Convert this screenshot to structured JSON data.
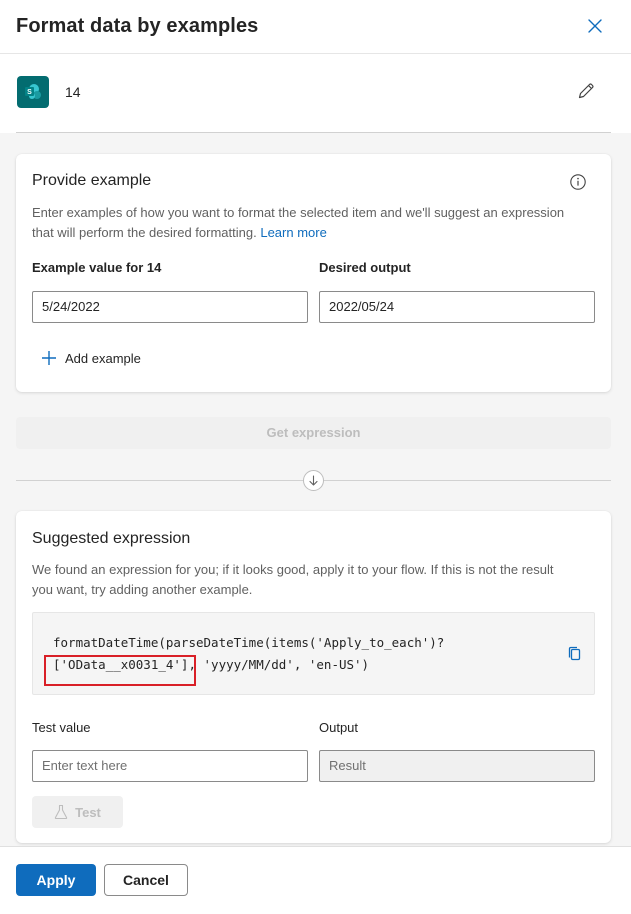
{
  "panel": {
    "title": "Format data by examples",
    "close_icon": "close-icon"
  },
  "connector": {
    "icon": "sharepoint-icon",
    "icon_color": "#036c70",
    "label": "14",
    "edit_icon": "pencil-icon"
  },
  "provide_example": {
    "title": "Provide example",
    "info_icon": "info-icon",
    "description": "Enter examples of how you want to format the selected item and we'll suggest an expression that will perform the desired formatting.",
    "learn_more": "Learn more",
    "example_label": "Example value for 14",
    "output_label": "Desired output",
    "example_value": "5/24/2022",
    "output_value": "2022/05/24",
    "add_example": "Add example"
  },
  "get_expression": {
    "label": "Get expression",
    "enabled": false
  },
  "suggested": {
    "title": "Suggested expression",
    "description": "We found an expression for you; if it looks good, apply it to your flow. If this is not the result you want, try adding another example.",
    "code_line1": "formatDateTime(parseDateTime(items('Apply_to_each')?",
    "code_line2": "['OData__x0031_4'], 'yyyy/MM/dd', 'en-US')",
    "copy_icon": "copy-icon",
    "highlight_color": "#d92027",
    "test_value_label": "Test value",
    "output_label": "Output",
    "test_placeholder": "Enter text here",
    "result_placeholder": "Result",
    "test_button": "Test",
    "test_icon": "flask-icon"
  },
  "footer": {
    "apply": "Apply",
    "cancel": "Cancel"
  },
  "colors": {
    "accent": "#0f6cbd",
    "background": "#f5f5f5"
  }
}
